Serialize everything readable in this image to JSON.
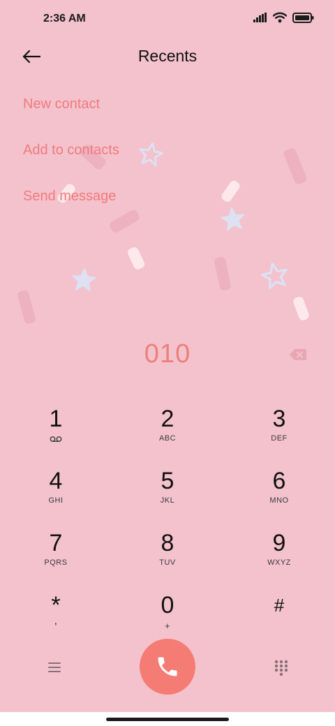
{
  "status_bar": {
    "time": "2:36 AM",
    "icons": [
      "signal-icon",
      "wifi-icon",
      "battery-icon"
    ]
  },
  "header": {
    "title": "Recents",
    "back_icon": "back-arrow-icon"
  },
  "actions": [
    {
      "label": "New contact"
    },
    {
      "label": "Add to contacts"
    },
    {
      "label": "Send message"
    }
  ],
  "dialer": {
    "number": "010",
    "backspace_icon": "backspace-icon"
  },
  "keypad": [
    {
      "digit": "1",
      "letters": ""
    },
    {
      "digit": "2",
      "letters": "ABC"
    },
    {
      "digit": "3",
      "letters": "DEF"
    },
    {
      "digit": "4",
      "letters": "GHI"
    },
    {
      "digit": "5",
      "letters": "JKL"
    },
    {
      "digit": "6",
      "letters": "MNO"
    },
    {
      "digit": "7",
      "letters": "PQRS"
    },
    {
      "digit": "8",
      "letters": "TUV"
    },
    {
      "digit": "9",
      "letters": "WXYZ"
    },
    {
      "digit": "*",
      "letters": ","
    },
    {
      "digit": "0",
      "letters": "+"
    },
    {
      "digit": "#",
      "letters": ""
    }
  ],
  "bottom_bar": {
    "menu_icon": "menu-icon",
    "call_icon": "phone-icon",
    "dialpad_icon": "dialpad-icon"
  },
  "colors": {
    "background": "#f3c2cd",
    "accent": "#f07b7b",
    "call_button": "#f57c74"
  }
}
